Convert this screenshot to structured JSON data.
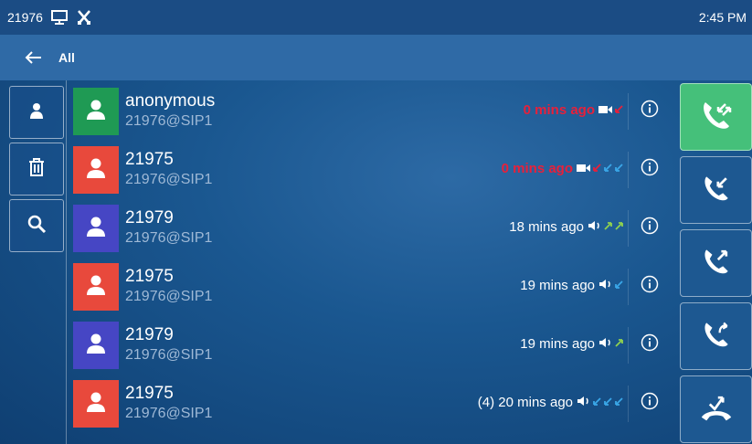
{
  "status_bar": {
    "extension": "21976",
    "time": "2:45 PM"
  },
  "header": {
    "title": "All"
  },
  "calls": [
    {
      "name": "anonymous",
      "account": "21976@SIP1",
      "time": "0 mins ago",
      "missed": true,
      "avatar_color": "#1f9a54",
      "audio": "video",
      "indicators": [
        "missed"
      ]
    },
    {
      "name": "21975",
      "account": "21976@SIP1",
      "time": "0 mins ago",
      "missed": true,
      "avatar_color": "#e8493c",
      "audio": "video",
      "indicators": [
        "missed",
        "incoming",
        "incoming"
      ]
    },
    {
      "name": "21979",
      "account": "21976@SIP1",
      "time": "18 mins ago",
      "missed": false,
      "avatar_color": "#4646c4",
      "audio": "speaker",
      "indicators": [
        "outgoing",
        "outgoing"
      ]
    },
    {
      "name": "21975",
      "account": "21976@SIP1",
      "time": "19 mins ago",
      "missed": false,
      "avatar_color": "#e8493c",
      "audio": "speaker",
      "indicators": [
        "incoming"
      ]
    },
    {
      "name": "21979",
      "account": "21976@SIP1",
      "time": "19 mins ago",
      "missed": false,
      "avatar_color": "#4646c4",
      "audio": "speaker",
      "indicators": [
        "outgoing"
      ]
    },
    {
      "name": "21975",
      "account": "21976@SIP1",
      "time": "(4) 20 mins ago",
      "missed": false,
      "avatar_color": "#e8493c",
      "audio": "speaker",
      "indicators": [
        "incoming",
        "incoming",
        "incoming"
      ]
    }
  ],
  "left_buttons": [
    "contact-icon",
    "trash-icon",
    "search-icon"
  ],
  "right_buttons": [
    "all-calls-icon",
    "received-calls-icon",
    "placed-calls-icon",
    "forwarded-calls-icon",
    "missed-calls-icon"
  ],
  "colors": {
    "missed_text": "#e8203a",
    "incoming_arrow": "#3aa7e8",
    "outgoing_arrow": "#8fd14f",
    "missed_arrow": "#e8203a",
    "active_tab": "#45c07a"
  }
}
